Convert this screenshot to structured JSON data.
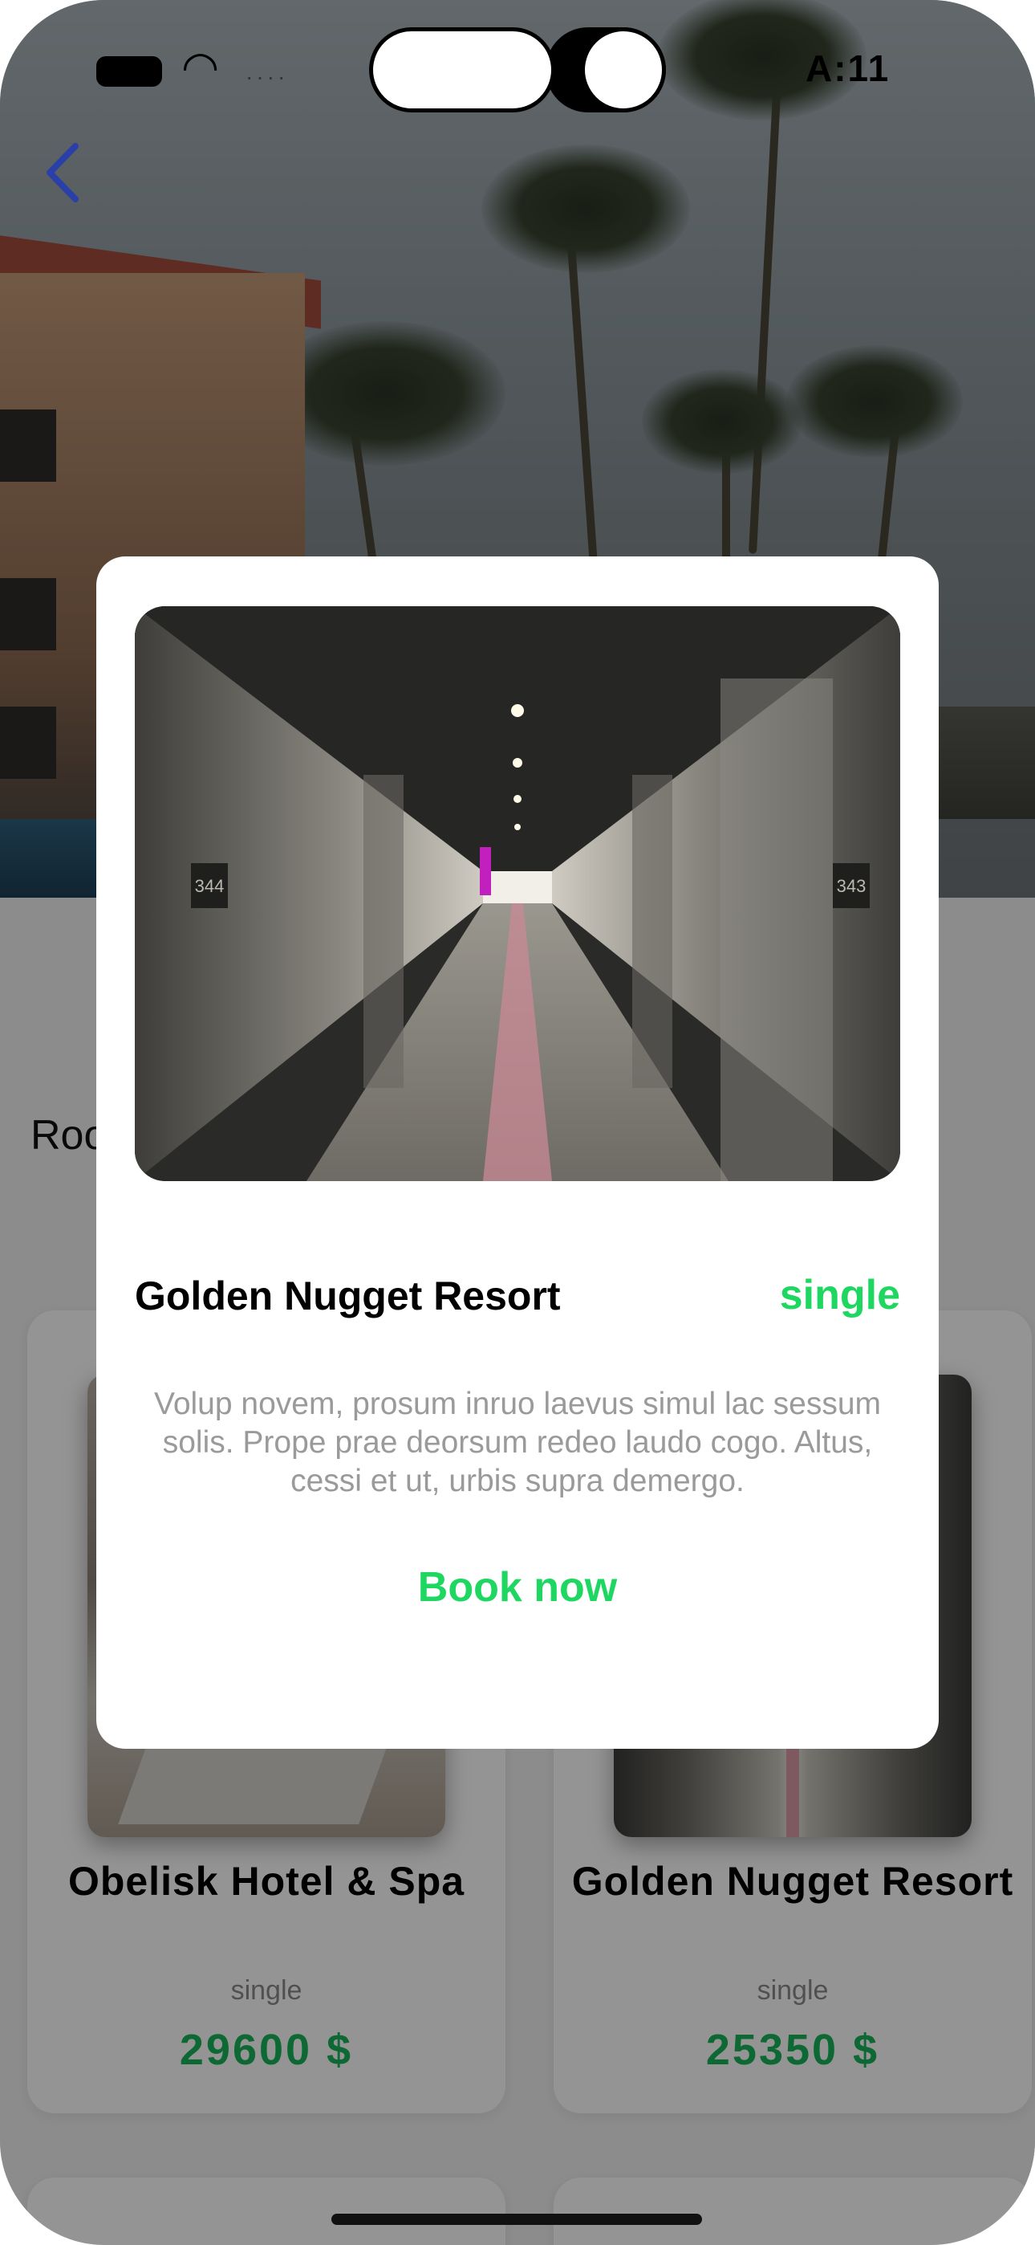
{
  "status_bar": {
    "time": "A:11",
    "signal": "····"
  },
  "navigation": {
    "back_icon": "chevron-left-icon"
  },
  "section": {
    "title": "Rooms"
  },
  "rooms": [
    {
      "name": "Obelisk Hotel & Spa",
      "type": "single",
      "price": "29600  $"
    },
    {
      "name": "Golden Nugget Resort",
      "type": "single",
      "price": "25350  $"
    }
  ],
  "modal": {
    "title": "Golden Nugget Resort",
    "type": "single",
    "description": "Volup novem, prosum inruo laevus simul lac sessum solis. Prope prae deorsum redeo laudo cogo. Altus, cessi et ut, urbis supra demergo.",
    "book_label": "Book now",
    "room_numbers": [
      "344",
      "343"
    ]
  },
  "colors": {
    "accent_green": "#1ed760",
    "price_green": "#19b45a",
    "back_icon_blue": "#2b3fa8"
  }
}
